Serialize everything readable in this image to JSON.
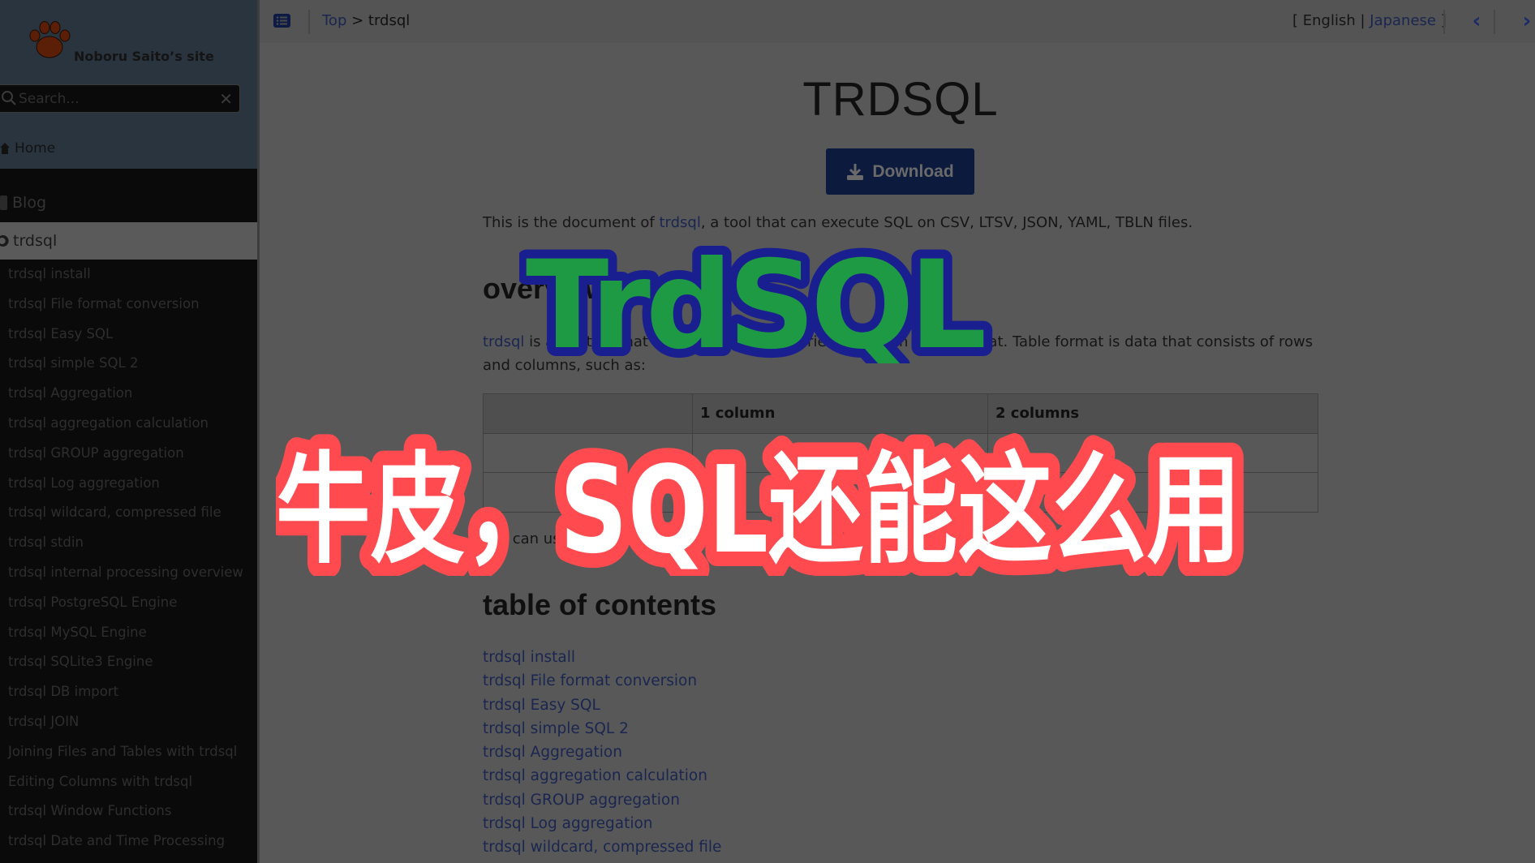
{
  "sidebar": {
    "site_name": "Noboru Saito’s site",
    "search_placeholder": "Search...",
    "search_value": "",
    "clear_label": "✕",
    "home_label": "Home",
    "blog_label": "Blog",
    "active_section_label": "trdsql",
    "items": [
      "trdsql install",
      "trdsql File format conversion",
      "trdsql Easy SQL",
      "trdsql simple SQL 2",
      "trdsql Aggregation",
      "trdsql aggregation calculation",
      "trdsql GROUP aggregation",
      "trdsql Log aggregation",
      "trdsql wildcard, compressed file",
      "trdsql stdin",
      "trdsql internal processing overview",
      "trdsql PostgreSQL Engine",
      "trdsql MySQL Engine",
      "trdsql SQLite3 Engine",
      "trdsql DB import",
      "trdsql JOIN",
      "Joining Files and Tables with trdsql",
      "Editing Columns with trdsql",
      "trdsql Window Functions",
      "trdsql Date and Time Processing"
    ]
  },
  "topbar": {
    "breadcrumb_top": "Top",
    "breadcrumb_sep": " > ",
    "breadcrumb_current": "trdsql",
    "lang_open": "[ ",
    "lang_english": "English",
    "lang_sep": " | ",
    "lang_japanese": "Japanese",
    "lang_close": " ]",
    "prev_label": "‹",
    "next_label": "›"
  },
  "main": {
    "title": "TRDSQL",
    "download_label": "Download",
    "intro_prefix": "This is the document of ",
    "intro_link": "trdsql",
    "intro_suffix": ", a tool that can execute SQL on CSV, LTSV, JSON, YAML, TBLN files.",
    "overview_heading": "overview",
    "overview_link": "trdsql",
    "overview_text": " is a CLI tool that can execute SQL queries on text in table format. Table format is data that consists of rows and columns, such as:",
    "table": {
      "headers": [
        "",
        "1 column",
        "2 columns"
      ],
      "rows": [
        [
          "",
          "",
          ""
        ],
        [
          "",
          "",
          ""
        ]
      ]
    },
    "after_table_text": "You can use the results of SQL queries on this data.",
    "toc_heading": "table of contents",
    "toc_items": [
      "trdsql install",
      "trdsql File format conversion",
      "trdsql Easy SQL",
      "trdsql simple SQL 2",
      "trdsql Aggregation",
      "trdsql aggregation calculation",
      "trdsql GROUP aggregation",
      "trdsql Log aggregation",
      "trdsql wildcard, compressed file"
    ]
  },
  "overlays": {
    "logo_text": "TrdSQL",
    "logo_fill": "#1e9a44",
    "logo_stroke": "#1a1f8f",
    "caption_text": "牛皮，SQL还能这么用",
    "caption_fill": "#ffffff",
    "caption_stroke": "#ff4b50"
  }
}
